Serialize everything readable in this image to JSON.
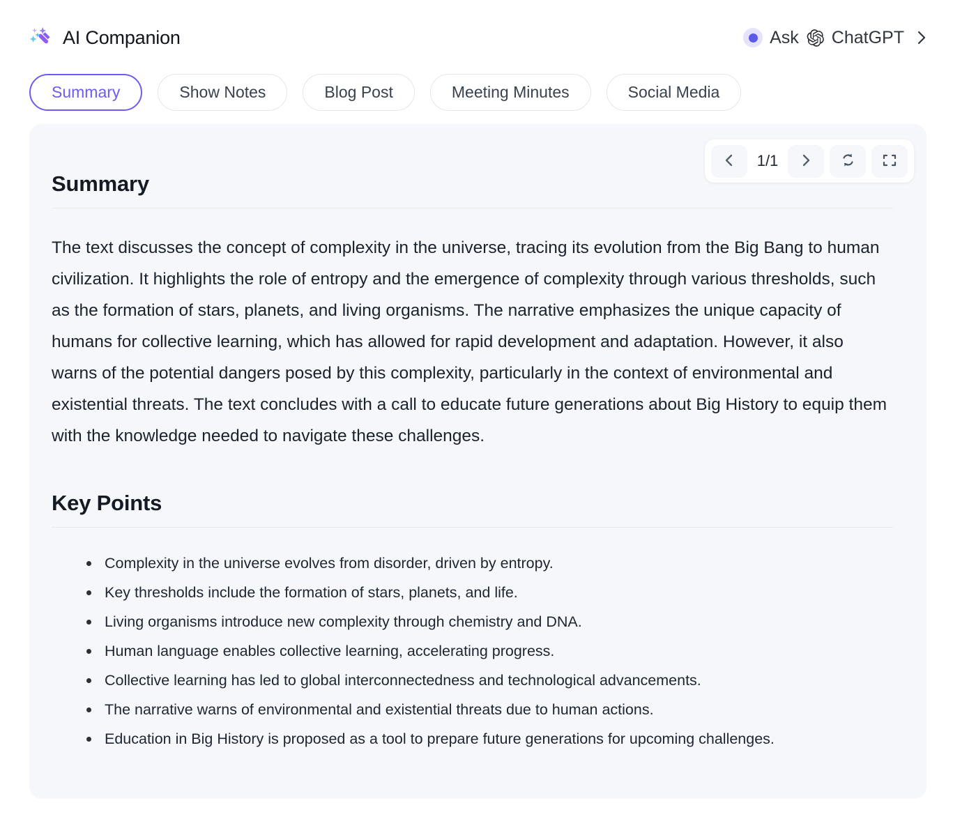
{
  "header": {
    "app_title": "AI Companion",
    "brand_icon": "magic-wand-sparkles-icon",
    "ask": {
      "label": "Ask",
      "product": "ChatGPT",
      "status_dot": "active-dot",
      "provider_icon": "openai-logo-icon",
      "chevron": "chevron-right-icon",
      "dot_color": "#5b5beb",
      "dot_halo_color": "#e5e3fb"
    }
  },
  "tabs": {
    "active_index": 0,
    "items": [
      {
        "label": "Summary"
      },
      {
        "label": "Show Notes"
      },
      {
        "label": "Blog Post"
      },
      {
        "label": "Meeting Minutes"
      },
      {
        "label": "Social Media"
      }
    ],
    "active_color": "#6b5cf6"
  },
  "toolbar": {
    "prev_icon": "chevron-left-icon",
    "next_icon": "chevron-right-icon",
    "page_indicator": "1/1",
    "regenerate_icon": "refresh-loop-icon",
    "fullscreen_icon": "expand-fullscreen-icon"
  },
  "content": {
    "summary_heading": "Summary",
    "summary_text": "The text discusses the concept of complexity in the universe, tracing its evolution from the Big Bang to human civilization. It highlights the role of entropy and the emergence of complexity through various thresholds, such as the formation of stars, planets, and living organisms. The narrative emphasizes the unique capacity of humans for collective learning, which has allowed for rapid development and adaptation. However, it also warns of the potential dangers posed by this complexity, particularly in the context of environmental and existential threats. The text concludes with a call to educate future generations about Big History to equip them with the knowledge needed to navigate these challenges.",
    "key_points_heading": "Key Points",
    "key_points": [
      "Complexity in the universe evolves from disorder, driven by entropy.",
      "Key thresholds include the formation of stars, planets, and life.",
      "Living organisms introduce new complexity through chemistry and DNA.",
      "Human language enables collective learning, accelerating progress.",
      "Collective learning has led to global interconnectedness and technological advancements.",
      "The narrative warns of environmental and existential threats due to human actions.",
      "Education in Big History is proposed as a tool to prepare future generations for upcoming challenges."
    ]
  },
  "theme": {
    "panel_background": "#f6f7fb",
    "page_background": "#ffffff",
    "text_color": "#1f2430"
  }
}
